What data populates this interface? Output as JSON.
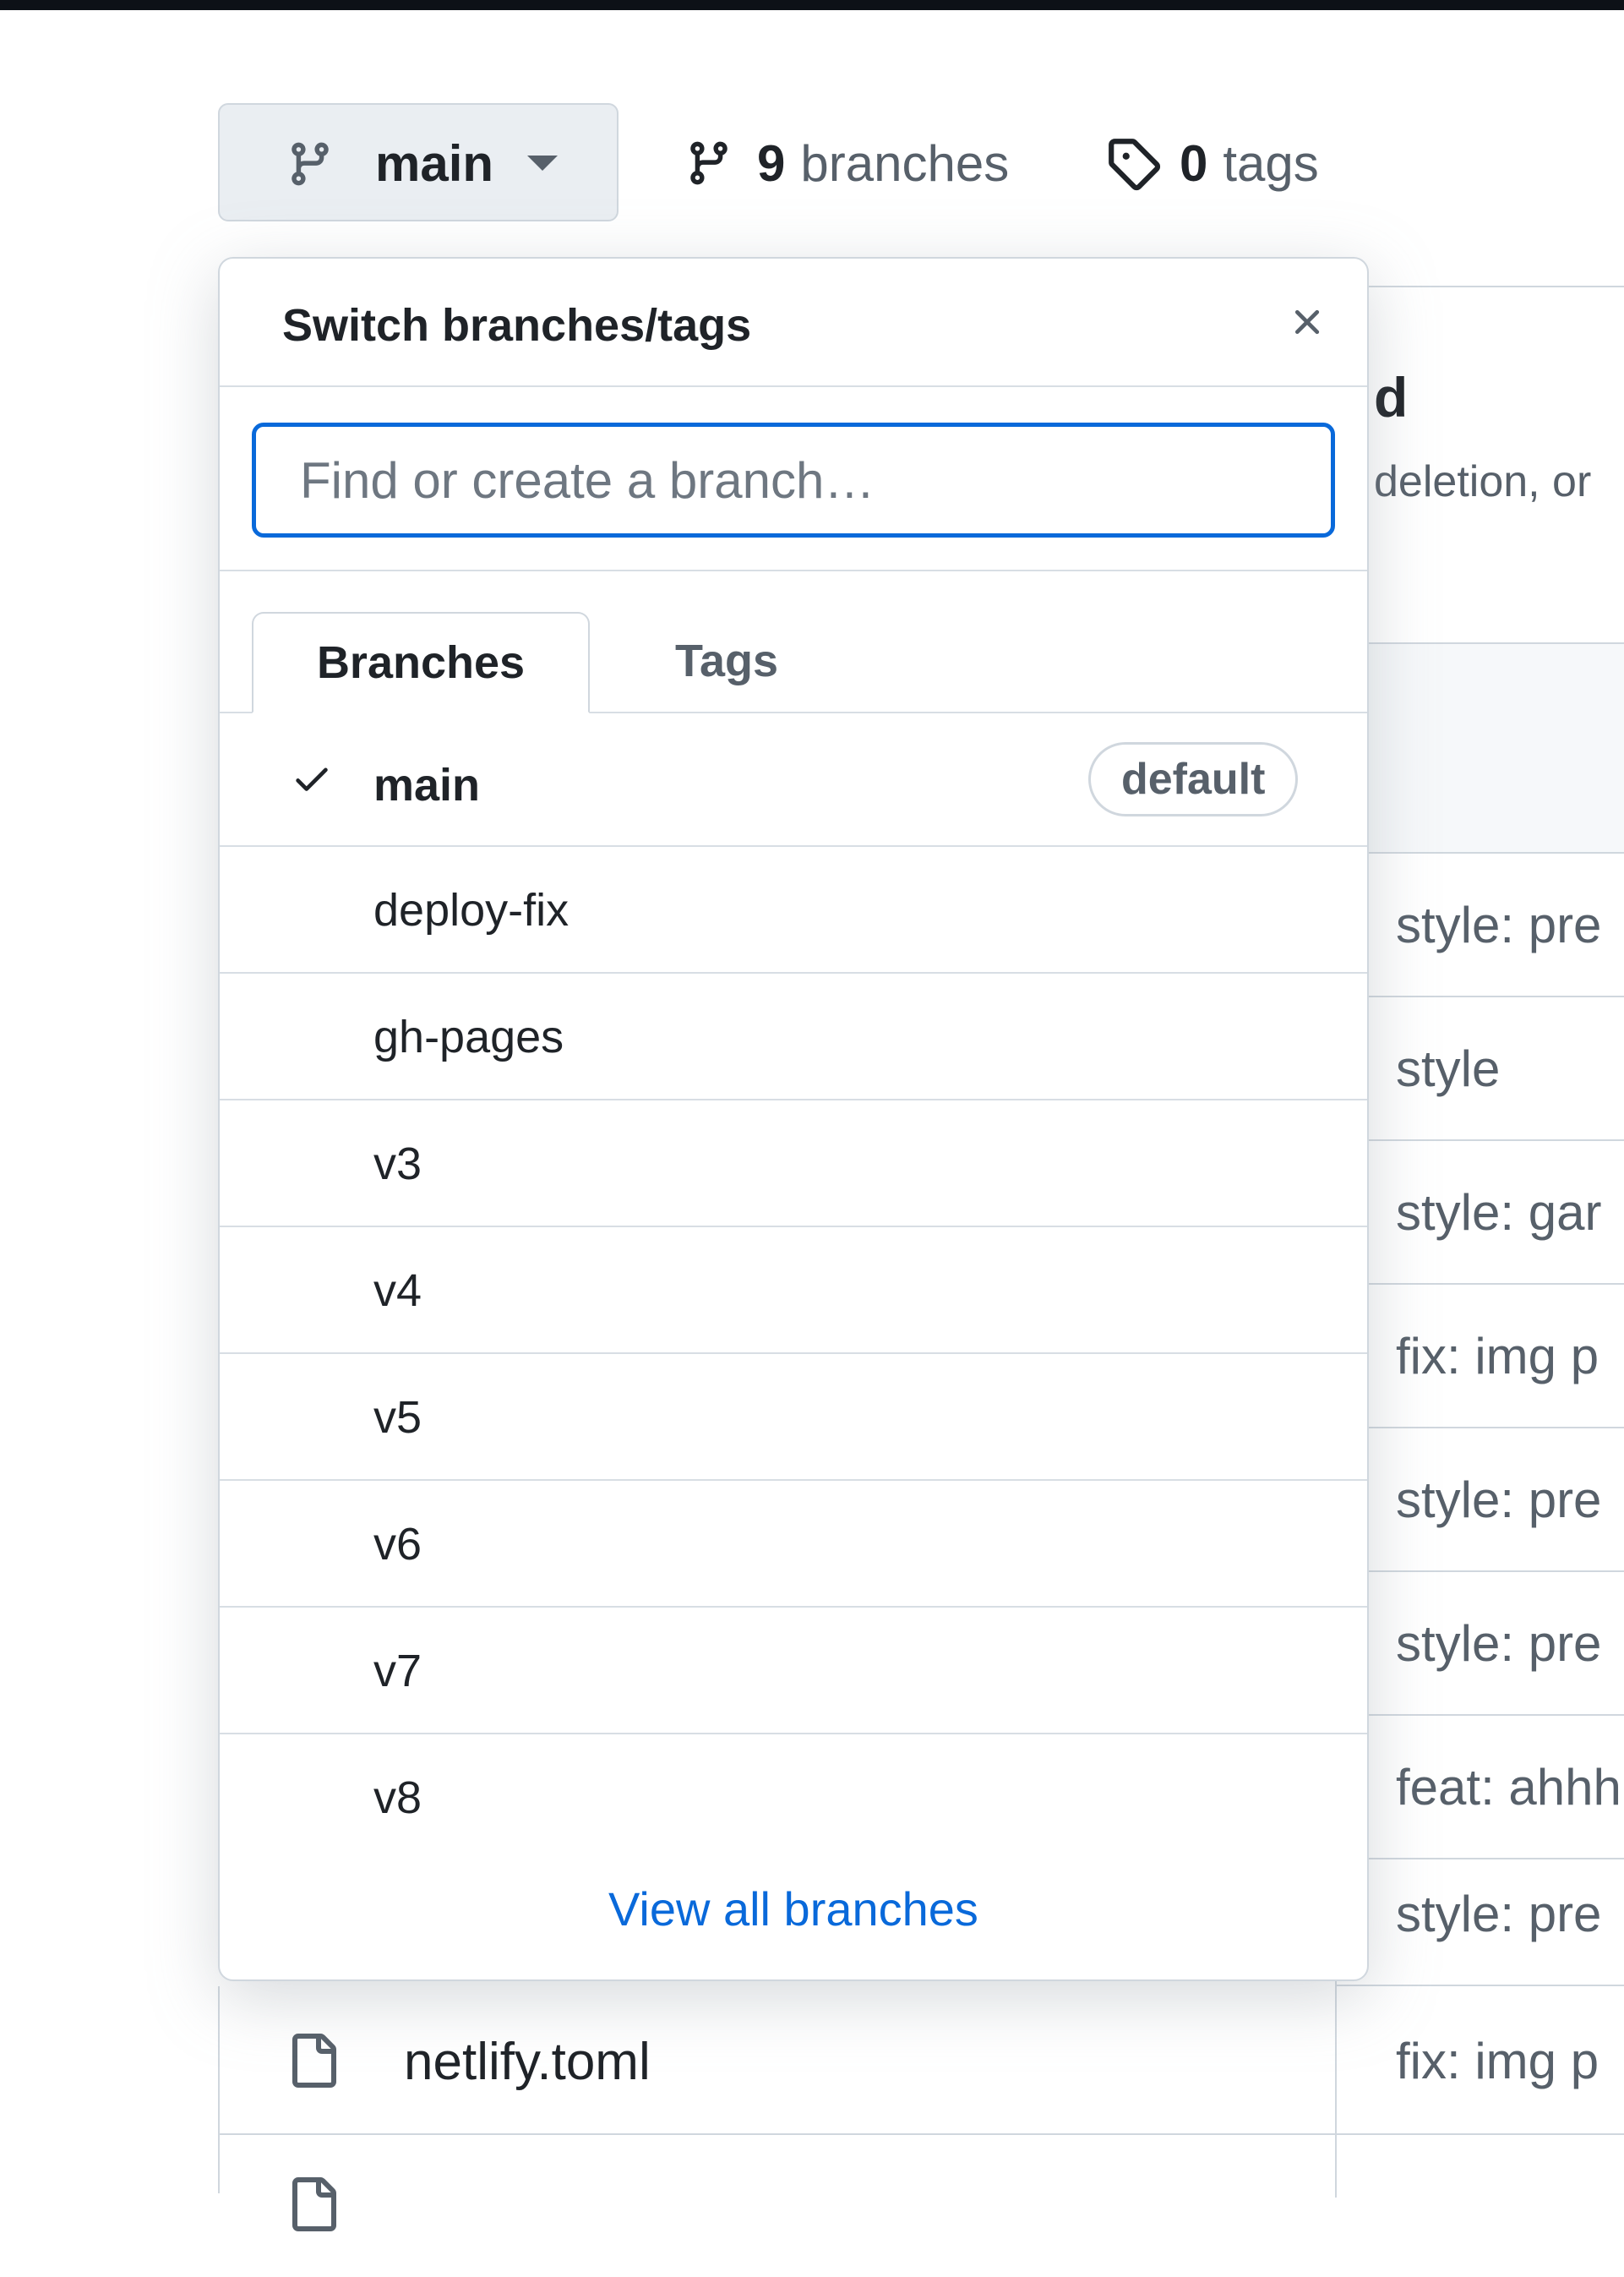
{
  "toolbar": {
    "branch_button_label": "main",
    "branches_count": "9",
    "branches_text": "branches",
    "tags_count": "0",
    "tags_text": "tags"
  },
  "popover": {
    "title": "Switch branches/tags",
    "search_placeholder": "Find or create a branch…",
    "tabs": [
      {
        "label": "Branches",
        "selected": true
      },
      {
        "label": "Tags",
        "selected": false
      }
    ],
    "branches": [
      {
        "name": "main",
        "selected": true,
        "badge": "default"
      },
      {
        "name": "deploy-fix"
      },
      {
        "name": "gh-pages"
      },
      {
        "name": "v3"
      },
      {
        "name": "v4"
      },
      {
        "name": "v5"
      },
      {
        "name": "v6"
      },
      {
        "name": "v7"
      },
      {
        "name": "v8"
      }
    ],
    "view_all_label": "View all branches"
  },
  "background": {
    "header_fragment": "d",
    "subtext_fragment": "deletion, or",
    "commit_messages": [
      "style: pre",
      "style",
      "style: gar",
      "fix: img p",
      "style: pre",
      "style: pre",
      "feat: ahhh",
      "style: pre"
    ],
    "file_row": {
      "name": "netlify.toml",
      "message": "fix: img p"
    }
  },
  "colors": {
    "accent": "#0969da",
    "border": "#d0d7de",
    "muted_text": "#57606a"
  }
}
